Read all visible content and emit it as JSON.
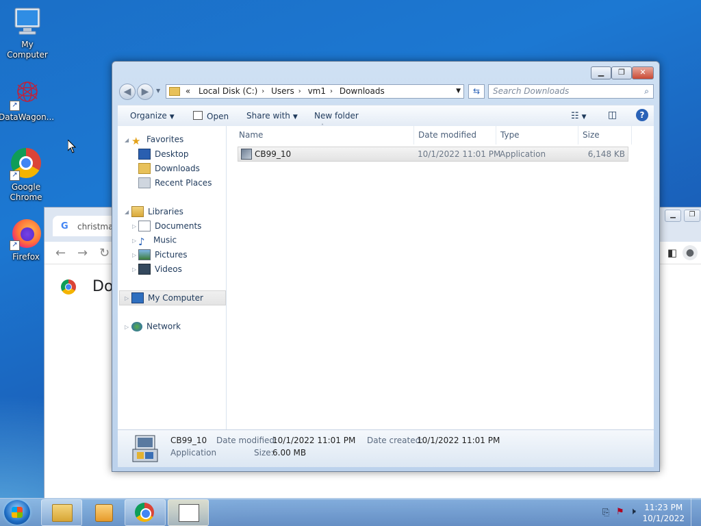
{
  "desktop": {
    "icons": [
      {
        "label": "My Computer"
      },
      {
        "label": "DataWagon..."
      },
      {
        "label": "Google Chrome"
      },
      {
        "label": "Firefox"
      }
    ]
  },
  "chrome": {
    "tab_title": "christmas",
    "tab_favicon": "G",
    "page_heading": "Do"
  },
  "explorer": {
    "address": {
      "overflow": "«",
      "crumbs": [
        "Local Disk (C:)",
        "Users",
        "vm1",
        "Downloads"
      ]
    },
    "search_placeholder": "Search Downloads",
    "toolbar": {
      "organize": "Organize",
      "open": "Open",
      "share_with": "Share with",
      "new_folder": "New folder"
    },
    "nav": {
      "favorites": "Favorites",
      "desktop": "Desktop",
      "downloads": "Downloads",
      "recent_places": "Recent Places",
      "libraries": "Libraries",
      "documents": "Documents",
      "music": "Music",
      "pictures": "Pictures",
      "videos": "Videos",
      "my_computer": "My Computer",
      "network": "Network"
    },
    "columns": [
      "Name",
      "Date modified",
      "Type",
      "Size"
    ],
    "files": [
      {
        "name": "CB99_10",
        "date_modified": "10/1/2022 11:01 PM",
        "type": "Application",
        "size": "6,148 KB"
      }
    ],
    "details": {
      "name": "CB99_10",
      "type": "Application",
      "date_modified_label": "Date modified:",
      "date_modified": "10/1/2022 11:01 PM",
      "date_created_label": "Date created:",
      "date_created": "10/1/2022 11:01 PM",
      "size_label": "Size:",
      "size": "6.00 MB"
    }
  },
  "taskbar": {
    "time": "11:23 PM",
    "date": "10/1/2022"
  }
}
